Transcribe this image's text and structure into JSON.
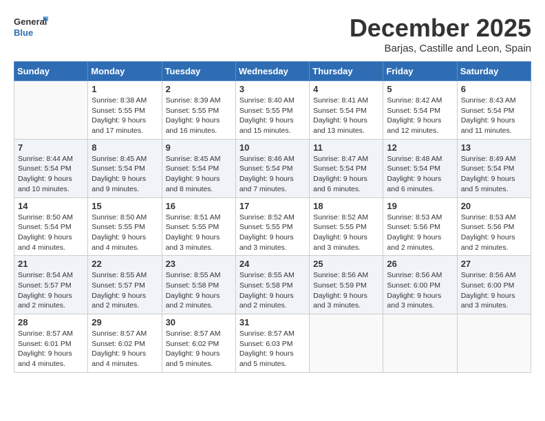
{
  "logo": {
    "general": "General",
    "blue": "Blue"
  },
  "title": "December 2025",
  "subtitle": "Barjas, Castille and Leon, Spain",
  "days_of_week": [
    "Sunday",
    "Monday",
    "Tuesday",
    "Wednesday",
    "Thursday",
    "Friday",
    "Saturday"
  ],
  "weeks": [
    [
      {
        "day": "",
        "text": ""
      },
      {
        "day": "1",
        "text": "Sunrise: 8:38 AM\nSunset: 5:55 PM\nDaylight: 9 hours and 17 minutes."
      },
      {
        "day": "2",
        "text": "Sunrise: 8:39 AM\nSunset: 5:55 PM\nDaylight: 9 hours and 16 minutes."
      },
      {
        "day": "3",
        "text": "Sunrise: 8:40 AM\nSunset: 5:55 PM\nDaylight: 9 hours and 15 minutes."
      },
      {
        "day": "4",
        "text": "Sunrise: 8:41 AM\nSunset: 5:54 PM\nDaylight: 9 hours and 13 minutes."
      },
      {
        "day": "5",
        "text": "Sunrise: 8:42 AM\nSunset: 5:54 PM\nDaylight: 9 hours and 12 minutes."
      },
      {
        "day": "6",
        "text": "Sunrise: 8:43 AM\nSunset: 5:54 PM\nDaylight: 9 hours and 11 minutes."
      }
    ],
    [
      {
        "day": "7",
        "text": "Sunrise: 8:44 AM\nSunset: 5:54 PM\nDaylight: 9 hours and 10 minutes."
      },
      {
        "day": "8",
        "text": "Sunrise: 8:45 AM\nSunset: 5:54 PM\nDaylight: 9 hours and 9 minutes."
      },
      {
        "day": "9",
        "text": "Sunrise: 8:45 AM\nSunset: 5:54 PM\nDaylight: 9 hours and 8 minutes."
      },
      {
        "day": "10",
        "text": "Sunrise: 8:46 AM\nSunset: 5:54 PM\nDaylight: 9 hours and 7 minutes."
      },
      {
        "day": "11",
        "text": "Sunrise: 8:47 AM\nSunset: 5:54 PM\nDaylight: 9 hours and 6 minutes."
      },
      {
        "day": "12",
        "text": "Sunrise: 8:48 AM\nSunset: 5:54 PM\nDaylight: 9 hours and 6 minutes."
      },
      {
        "day": "13",
        "text": "Sunrise: 8:49 AM\nSunset: 5:54 PM\nDaylight: 9 hours and 5 minutes."
      }
    ],
    [
      {
        "day": "14",
        "text": "Sunrise: 8:50 AM\nSunset: 5:54 PM\nDaylight: 9 hours and 4 minutes."
      },
      {
        "day": "15",
        "text": "Sunrise: 8:50 AM\nSunset: 5:55 PM\nDaylight: 9 hours and 4 minutes."
      },
      {
        "day": "16",
        "text": "Sunrise: 8:51 AM\nSunset: 5:55 PM\nDaylight: 9 hours and 3 minutes."
      },
      {
        "day": "17",
        "text": "Sunrise: 8:52 AM\nSunset: 5:55 PM\nDaylight: 9 hours and 3 minutes."
      },
      {
        "day": "18",
        "text": "Sunrise: 8:52 AM\nSunset: 5:55 PM\nDaylight: 9 hours and 3 minutes."
      },
      {
        "day": "19",
        "text": "Sunrise: 8:53 AM\nSunset: 5:56 PM\nDaylight: 9 hours and 2 minutes."
      },
      {
        "day": "20",
        "text": "Sunrise: 8:53 AM\nSunset: 5:56 PM\nDaylight: 9 hours and 2 minutes."
      }
    ],
    [
      {
        "day": "21",
        "text": "Sunrise: 8:54 AM\nSunset: 5:57 PM\nDaylight: 9 hours and 2 minutes."
      },
      {
        "day": "22",
        "text": "Sunrise: 8:55 AM\nSunset: 5:57 PM\nDaylight: 9 hours and 2 minutes."
      },
      {
        "day": "23",
        "text": "Sunrise: 8:55 AM\nSunset: 5:58 PM\nDaylight: 9 hours and 2 minutes."
      },
      {
        "day": "24",
        "text": "Sunrise: 8:55 AM\nSunset: 5:58 PM\nDaylight: 9 hours and 2 minutes."
      },
      {
        "day": "25",
        "text": "Sunrise: 8:56 AM\nSunset: 5:59 PM\nDaylight: 9 hours and 3 minutes."
      },
      {
        "day": "26",
        "text": "Sunrise: 8:56 AM\nSunset: 6:00 PM\nDaylight: 9 hours and 3 minutes."
      },
      {
        "day": "27",
        "text": "Sunrise: 8:56 AM\nSunset: 6:00 PM\nDaylight: 9 hours and 3 minutes."
      }
    ],
    [
      {
        "day": "28",
        "text": "Sunrise: 8:57 AM\nSunset: 6:01 PM\nDaylight: 9 hours and 4 minutes."
      },
      {
        "day": "29",
        "text": "Sunrise: 8:57 AM\nSunset: 6:02 PM\nDaylight: 9 hours and 4 minutes."
      },
      {
        "day": "30",
        "text": "Sunrise: 8:57 AM\nSunset: 6:02 PM\nDaylight: 9 hours and 5 minutes."
      },
      {
        "day": "31",
        "text": "Sunrise: 8:57 AM\nSunset: 6:03 PM\nDaylight: 9 hours and 5 minutes."
      },
      {
        "day": "",
        "text": ""
      },
      {
        "day": "",
        "text": ""
      },
      {
        "day": "",
        "text": ""
      }
    ]
  ]
}
